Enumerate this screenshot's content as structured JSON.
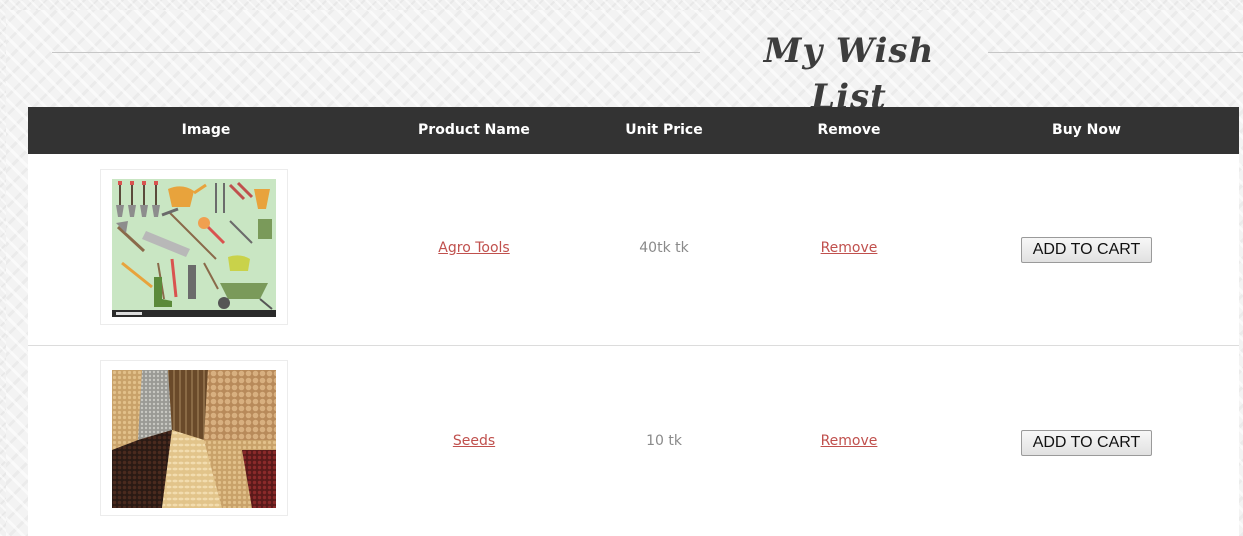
{
  "page": {
    "title": "My Wish List"
  },
  "table": {
    "headers": {
      "image": "Image",
      "name": "Product Name",
      "price": "Unit Price",
      "remove": "Remove",
      "buy": "Buy Now"
    },
    "rows": [
      {
        "product_name": "Agro Tools",
        "unit_price": "40tk tk",
        "remove_label": "Remove",
        "buy_label": "ADD TO CART",
        "image_icon": "agro-tools-image"
      },
      {
        "product_name": "Seeds",
        "unit_price": "10 tk",
        "remove_label": "Remove",
        "buy_label": "ADD TO CART",
        "image_icon": "seeds-image"
      }
    ]
  },
  "colors": {
    "header_bg": "#333333",
    "link": "#c0504d",
    "price_text": "#8a8a8a"
  }
}
